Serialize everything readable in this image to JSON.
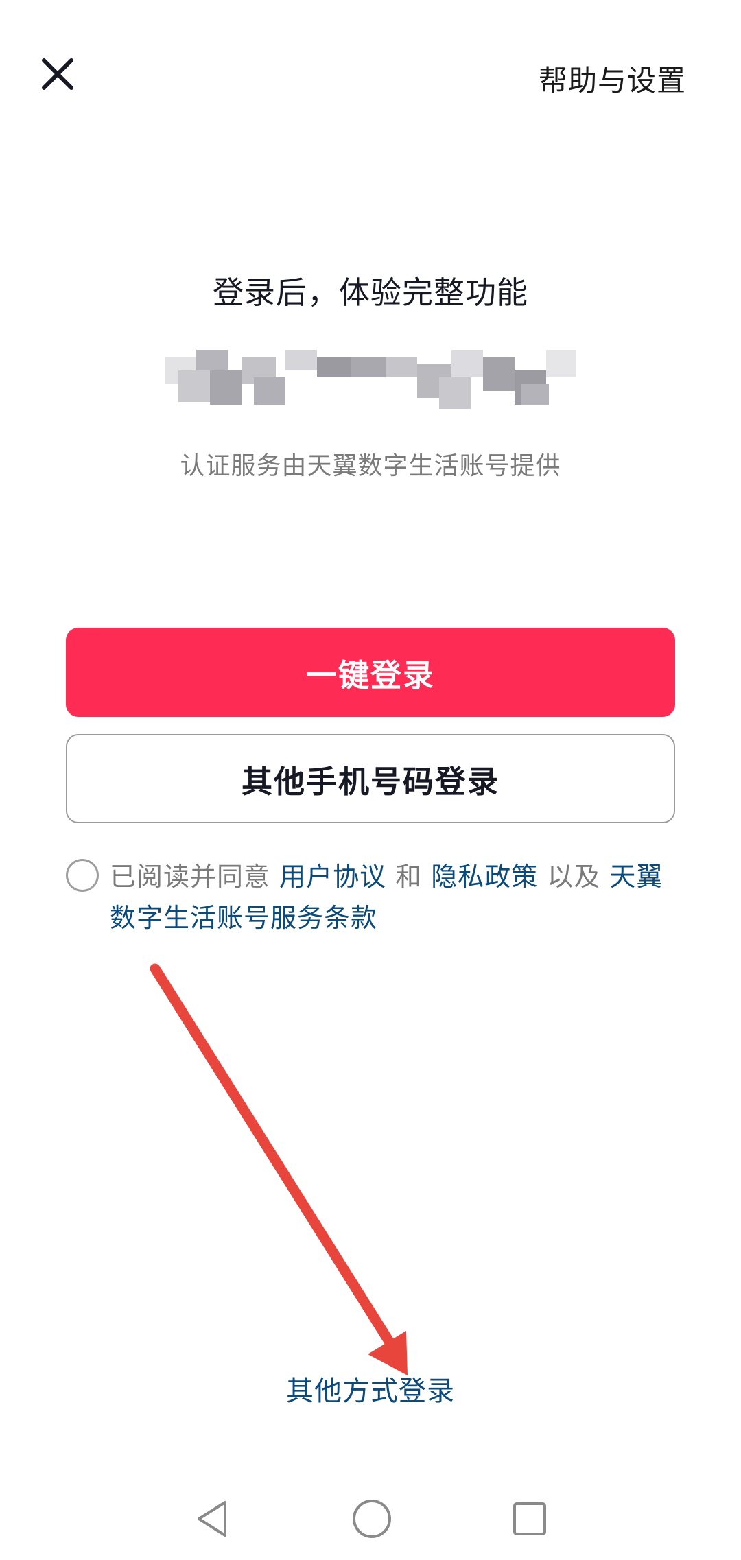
{
  "top_bar": {
    "close_icon": "close-icon",
    "help_label": "帮助与设置"
  },
  "header": {
    "headline": "登录后，体验完整功能",
    "provider_note": "认证服务由天翼数字生活账号提供"
  },
  "actions": {
    "one_click_login": "一键登录",
    "other_phone_login": "其他手机号码登录"
  },
  "agreement": {
    "prefix": "已阅读并同意 ",
    "user_agreement": "用户协议",
    "and": " 和 ",
    "privacy_policy": "隐私政策",
    "as_well_as": " 以及 ",
    "account_terms": "天翼数字生活账号服务条款"
  },
  "footer": {
    "other_method_login": "其他方式登录"
  },
  "nav_bar": {
    "back_icon": "back-triangle-icon",
    "home_icon": "home-circle-icon",
    "recent_icon": "recent-square-icon"
  },
  "colors": {
    "primary": "#fe2c55",
    "link": "#0b4a7a",
    "annotation_arrow": "#e8453c"
  }
}
